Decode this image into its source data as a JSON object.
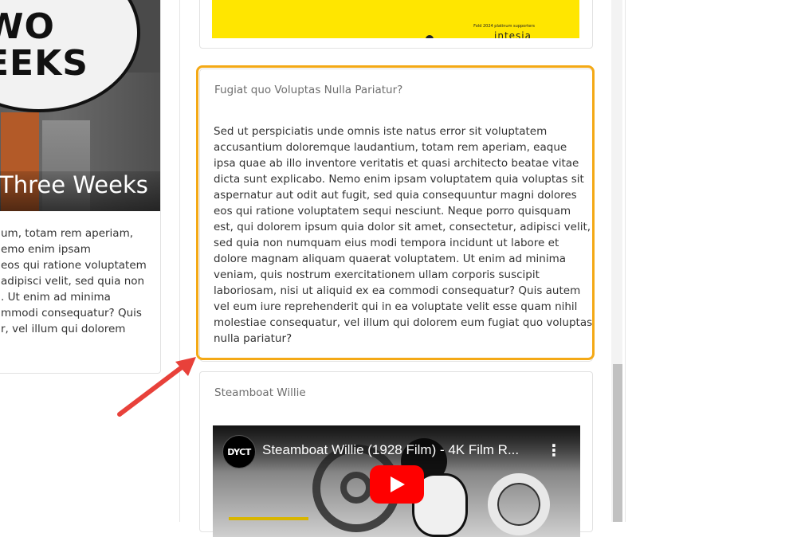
{
  "left_card": {
    "image_lines": [
      "WO",
      "EEKS"
    ],
    "title": "Three Weeks",
    "text_lines": [
      "um, totam rem aperiam,",
      "emo enim ipsam",
      "eos qui ratione voluptatem",
      "adipisci velit, sed quia non",
      ". Ut enim ad minima",
      "mmodi consequatur? Quis",
      "r, vel illum qui dolorem"
    ]
  },
  "ad_banner": {
    "small_text": "Fold 2024 platinum supporters",
    "logo_text": "intesia",
    "background": "#ffe600"
  },
  "text_card": {
    "title": "Fugiat quo Voluptas Nulla Pariatur?",
    "body_lines": [
      "Sed ut perspiciatis unde omnis iste natus error sit voluptatem",
      "accusantium doloremque laudantium, totam rem aperiam, eaque",
      "ipsa quae ab illo inventore veritatis et quasi architecto beatae vitae",
      "dicta sunt explicabo. Nemo enim ipsam voluptatem quia voluptas sit",
      "aspernatur aut odit aut fugit, sed quia consequuntur magni dolores",
      "eos qui ratione voluptatem sequi nesciunt. Neque porro quisquam",
      "est, qui dolorem ipsum quia dolor sit amet, consectetur, adipisci velit,",
      "sed quia non numquam eius modi tempora incidunt ut labore et",
      "dolore magnam aliquam quaerat voluptatem. Ut enim ad minima",
      "veniam, quis nostrum exercitationem ullam corporis suscipit",
      "laboriosam, nisi ut aliquid ex ea commodi consequatur? Quis autem",
      "vel eum iure reprehenderit qui in ea voluptate velit esse quam nihil",
      "molestiae consequatur, vel illum qui dolorem eum fugiat quo voluptas",
      "nulla pariatur?"
    ],
    "highlight_color": "#f4a916"
  },
  "video_card": {
    "title": "Steamboat Willie",
    "video_title": "Steamboat Willie (1928 Film) - 4K Film R...",
    "channel_avatar_text": "DYCT",
    "more_icon": "⋮",
    "play_color": "#ff0000"
  },
  "annotation": {
    "arrow_color": "#e8413a"
  }
}
